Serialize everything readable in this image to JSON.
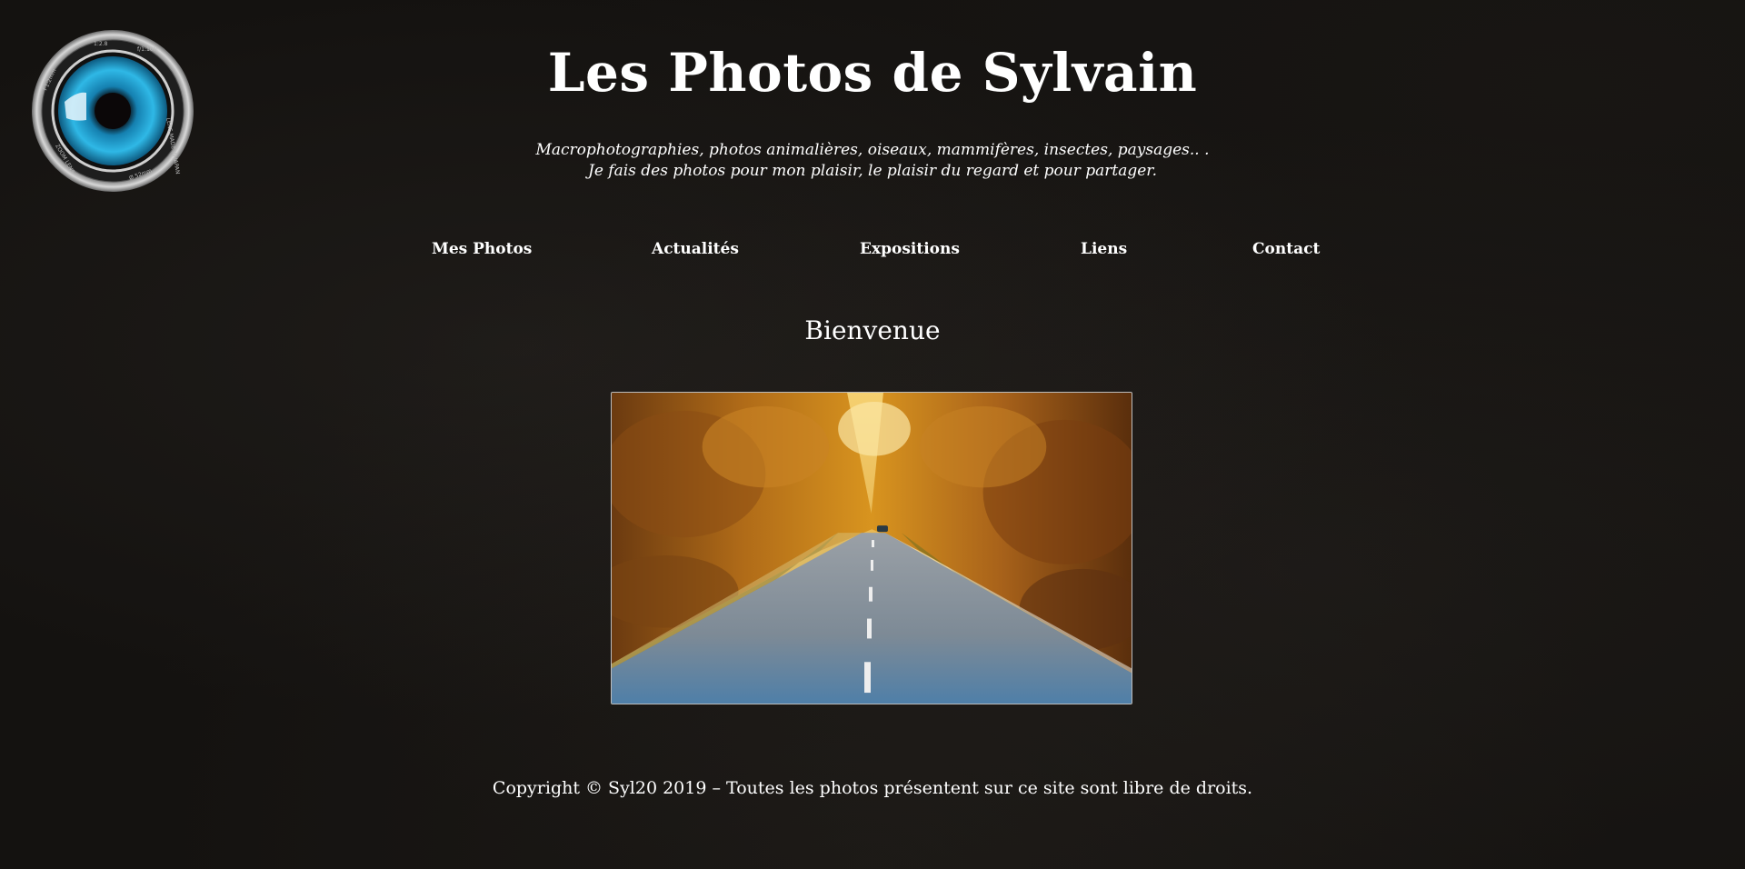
{
  "site": {
    "title": "Les Photos de Sylvain",
    "tagline_line1": "Macrophotographies, photos animalières, oiseaux, mammifères, insectes, paysages.. .",
    "tagline_line2": "Je fais des photos pour mon plaisir, le plaisir du regard et pour partager.",
    "logo_icon": "camera-lens-eye-icon"
  },
  "nav": {
    "items": [
      {
        "label": "Mes Photos"
      },
      {
        "label": "Actualités"
      },
      {
        "label": "Expositions"
      },
      {
        "label": "Liens"
      },
      {
        "label": "Contact"
      }
    ]
  },
  "main": {
    "heading": "Bienvenue",
    "photo_subject": "autumn-forest-road"
  },
  "footer": {
    "copyright": "Copyright © Syl20 2019 – Toutes les photos présentent sur ce site sont libre de droits."
  },
  "colors": {
    "background": "#141210",
    "text": "#ffffff",
    "iris": "#2fb8e6",
    "foliage": "#c07a1a"
  }
}
